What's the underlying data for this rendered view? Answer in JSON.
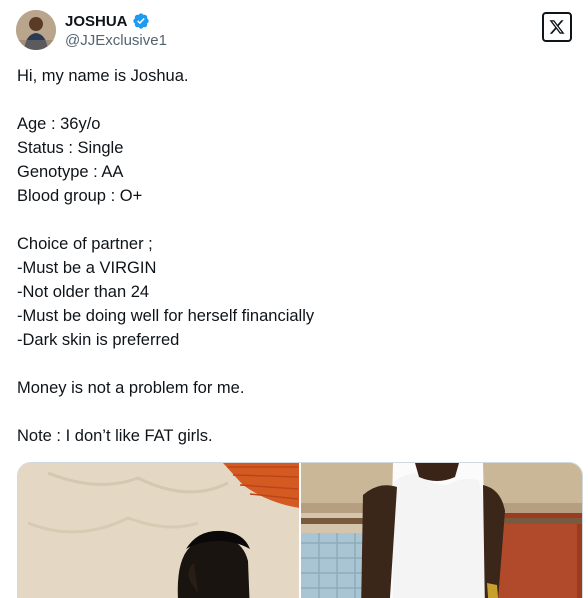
{
  "author": {
    "name": "JOSHUA",
    "handle": "@JJExclusive1",
    "verified_color": "#1d9bf0"
  },
  "icons": {
    "verified": "verified-badge-icon",
    "platform": "x-logo-icon"
  },
  "tweet": {
    "lines": [
      "Hi, my name is Joshua.",
      "",
      "Age : 36y/o",
      "Status : Single",
      "Genotype : AA",
      "Blood group : O+",
      "",
      "Choice of partner ;",
      "-Must be a VIRGIN",
      "-Not older than 24",
      "-Must be doing well for herself financially",
      "-Dark skin is preferred",
      "",
      "Money is not a problem for me.",
      "",
      "Note : I don’t like FAT girls."
    ]
  }
}
